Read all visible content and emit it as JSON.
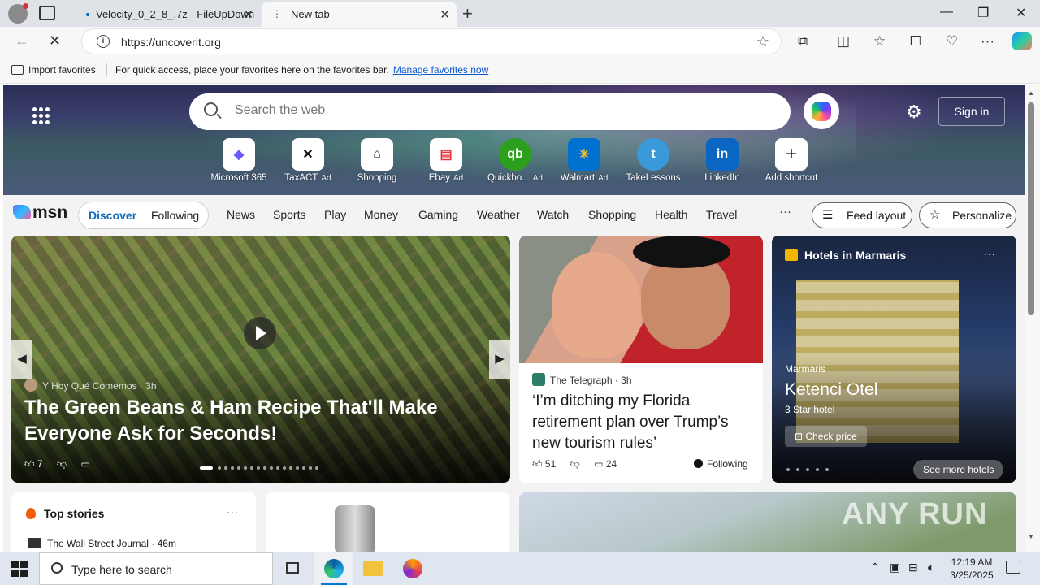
{
  "browser": {
    "tabs": [
      {
        "title": "Velocity_0_2_8_.7z - FileUpDown"
      },
      {
        "title": "New tab"
      }
    ],
    "url": "https://uncoverit.org",
    "favorites_bar": {
      "import_label": "Import favorites",
      "message": "For quick access, place your favorites here on the favorites bar.",
      "link": "Manage favorites now"
    }
  },
  "msn": {
    "search_placeholder": "Search the web",
    "sign_in": "Sign in",
    "shortcuts": [
      {
        "label": "Microsoft 365",
        "ad": "",
        "icon": "m365-icon"
      },
      {
        "label": "TaxACT",
        "ad": "Ad",
        "icon": "taxact-icon"
      },
      {
        "label": "Shopping",
        "ad": "",
        "icon": "tag-icon"
      },
      {
        "label": "Ebay",
        "ad": "Ad",
        "icon": "ebay-icon"
      },
      {
        "label": "Quickbo...",
        "ad": "Ad",
        "icon": "quickbooks-icon"
      },
      {
        "label": "Walmart",
        "ad": "Ad",
        "icon": "walmart-icon"
      },
      {
        "label": "TakeLessons",
        "ad": "",
        "icon": "takelessons-icon"
      },
      {
        "label": "LinkedIn",
        "ad": "",
        "icon": "linkedin-icon"
      },
      {
        "label": "Add shortcut",
        "ad": "",
        "icon": "plus-icon"
      }
    ],
    "logo": "msn",
    "discover": "Discover",
    "following": "Following",
    "categories": [
      "News",
      "Sports",
      "Play",
      "Money",
      "Gaming",
      "Weather",
      "Watch",
      "Shopping",
      "Health",
      "Travel"
    ],
    "more": "···",
    "feed_layout": "Feed layout",
    "personalize": "Personalize"
  },
  "cards": {
    "main": {
      "source": "Y Hoy Qué Comemos",
      "age": "3h",
      "title": "The Green Beans & Ham Recipe That'll Make Everyone Ask for Seconds!",
      "likes": "7"
    },
    "second": {
      "source": "The Telegraph",
      "age": "3h",
      "title": "‘I’m ditching my Florida retirement plan over Trump’s new tourism rules’",
      "likes": "51",
      "comments": "24",
      "following": "Following"
    },
    "hotel": {
      "header": "Hotels in Marmaris",
      "location": "Marmaris",
      "name": "Ketenci Otel",
      "stars": "3 Star hotel",
      "check_price": "Check price",
      "see_more": "See more hotels"
    },
    "top_stories": {
      "header": "Top stories",
      "source": "The Wall Street Journal · 46m"
    }
  },
  "watermark": "ANY RUN",
  "taskbar": {
    "search_placeholder": "Type here to search",
    "time": "12:19 AM",
    "date": "3/25/2025"
  },
  "colors": {
    "accent": "#0f6cbd",
    "link": "#0b57d0"
  }
}
